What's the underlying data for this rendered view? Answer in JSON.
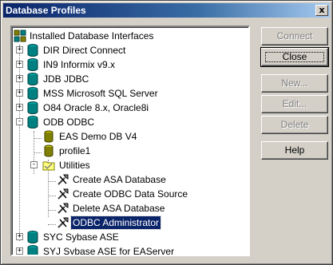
{
  "window": {
    "title": "Database Profiles",
    "close_glyph": "x"
  },
  "tree": {
    "root": "Installed Database Interfaces",
    "items": [
      {
        "label": "DIR Direct Connect",
        "expander": "+"
      },
      {
        "label": "IN9 Informix v9.x",
        "expander": "+"
      },
      {
        "label": "JDB JDBC",
        "expander": "+"
      },
      {
        "label": "MSS Microsoft SQL Server",
        "expander": "+"
      },
      {
        "label": "O84 Oracle 8.x, Oracle8i",
        "expander": "+"
      },
      {
        "label": "ODB ODBC",
        "expander": "-"
      },
      {
        "label": "EAS Demo DB V4"
      },
      {
        "label": "profile1"
      },
      {
        "label": "Utilities",
        "expander": "-"
      },
      {
        "label": "Create ASA Database"
      },
      {
        "label": "Create ODBC Data Source"
      },
      {
        "label": "Delete ASA Database"
      },
      {
        "label": "ODBC Administrator",
        "selected": true
      },
      {
        "label": "SYC Sybase ASE",
        "expander": "+"
      },
      {
        "label": "SYJ Sybase ASE for EAServer",
        "expander": "+"
      }
    ]
  },
  "buttons": {
    "connect": "Connect",
    "close": "Close",
    "new": "New...",
    "edit": "Edit...",
    "delete": "Delete",
    "help": "Help"
  },
  "colors": {
    "title_active": "#0a246a",
    "face": "#d4d0c8",
    "selection": "#0a246a"
  }
}
